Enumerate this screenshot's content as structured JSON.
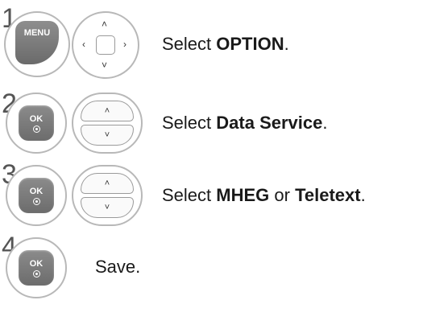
{
  "steps": [
    {
      "number": "1",
      "buttons": [
        "MENU"
      ],
      "text_prefix": "Select ",
      "target": "OPTION",
      "text_suffix": "."
    },
    {
      "number": "2",
      "buttons": [
        "OK"
      ],
      "text_prefix": "Select ",
      "target": "Data Service",
      "text_suffix": "."
    },
    {
      "number": "3",
      "buttons": [
        "OK"
      ],
      "text_prefix": "Select ",
      "target": "MHEG",
      "connector": " or ",
      "target2": "Teletext",
      "text_suffix": "."
    },
    {
      "number": "4",
      "buttons": [
        "OK"
      ],
      "text": "Save."
    }
  ],
  "icons": {
    "up": "chevron-up-icon",
    "down": "chevron-down-icon",
    "left": "chevron-left-icon",
    "right": "chevron-right-icon"
  },
  "colors": {
    "button_gray": "#7a7a7a",
    "ring_gray": "#b8b8b8",
    "text": "#1a1a1a"
  }
}
